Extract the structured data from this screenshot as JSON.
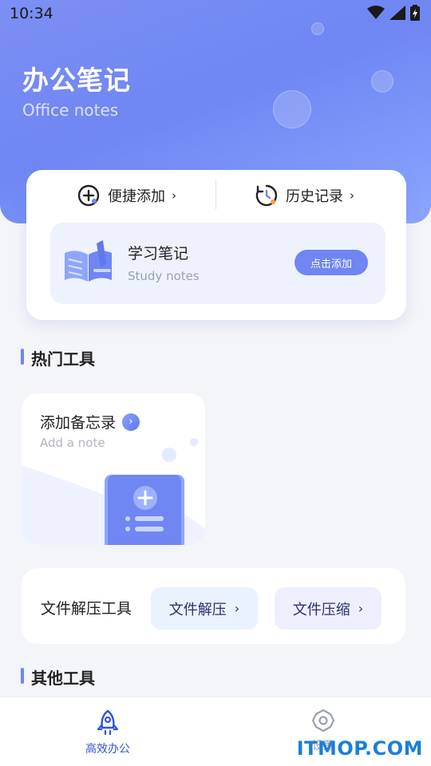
{
  "status": {
    "time": "10:34"
  },
  "header": {
    "title": "办公笔记",
    "subtitle": "Office notes"
  },
  "quick": {
    "add_label": "便捷添加",
    "history_label": "历史记录"
  },
  "study": {
    "title": "学习笔记",
    "subtitle": "Study notes",
    "button": "点击添加"
  },
  "hot": {
    "section_title": "热门工具",
    "memo_title": "添加备忘录",
    "memo_subtitle": "Add a note"
  },
  "zip": {
    "label": "文件解压工具",
    "extract_label": "文件解压",
    "compress_label": "文件压缩"
  },
  "other": {
    "section_title": "其他工具"
  },
  "nav": {
    "office_label": "高效办公",
    "settings_label": "设置"
  },
  "watermark": "ITMOP.COM",
  "colors": {
    "accent": "#6f86f3",
    "card_tint": "#eef2fe",
    "zip_btn_1": "#eaf3fd",
    "zip_btn_2": "#eeeffd"
  }
}
